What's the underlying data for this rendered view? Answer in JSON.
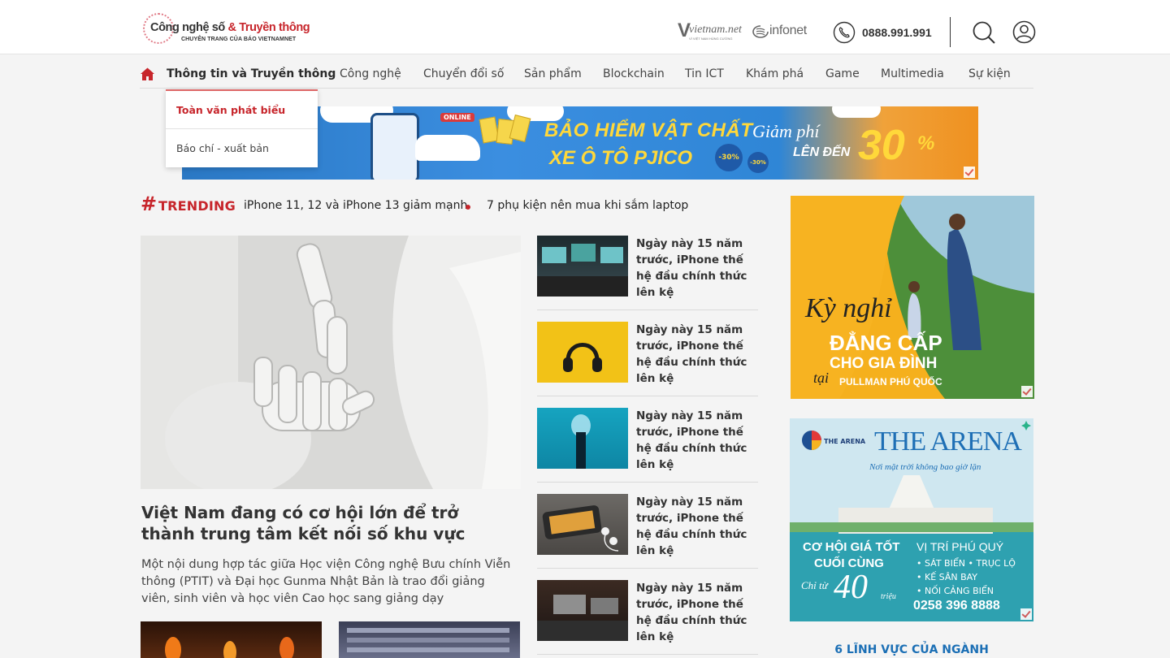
{
  "header": {
    "logo_main": "Công nghệ số",
    "logo_amp": "& Truyền thông",
    "logo_sub": "CHUYÊN TRANG CỦA BÁO VIETNAMNET",
    "partner_vietnamnet": "vietnam.net",
    "partner_vietnamnet_sub": "VÌ VIỆT NAM HÙNG CƯỜNG",
    "partner_infonet": "infonet",
    "hotline": "0888.991.991"
  },
  "nav": {
    "items": [
      "Thông tin và Truyền thông",
      "Công nghệ",
      "Chuyển đổi số",
      "Sản phẩm",
      "Blockchain",
      "Tin ICT",
      "Khám phá",
      "Game",
      "Multimedia",
      "Sự kiện"
    ],
    "dropdown": [
      "Toàn văn phát biểu",
      "Báo chí - xuất bản"
    ]
  },
  "banner": {
    "online": "ONLINE",
    "line1": "BẢO HIỂM VẬT CHẤT",
    "line2": "XE Ô TÔ PJICO",
    "badge": "-30%",
    "badge2": "-30%",
    "giam": "Giảm phí",
    "len_den": "LÊN ĐẾN",
    "value": "30",
    "pct": "%"
  },
  "trending": {
    "label": "TRENDING",
    "items": [
      "iPhone 11, 12 và iPhone 13 giảm mạnh",
      "7 phụ kiện nên mua khi sắm laptop"
    ]
  },
  "main": {
    "title": "Việt Nam đang có cơ hội lớn để trở thành trung tâm kết nối số khu vực",
    "sapo": "Một nội dung hợp tác giữa Học viện Công nghệ Bưu chính Viễn thông (PTIT) và Đại học Gunma Nhật Bản là trao đổi giảng viên, sinh viên và học viên Cao học sang giảng dạy"
  },
  "side": {
    "items": [
      {
        "title": "Ngày này 15 năm trước, iPhone thế hệ đầu chính thức lên kệ"
      },
      {
        "title": "Ngày này 15 năm trước, iPhone thế hệ đầu chính thức lên kệ"
      },
      {
        "title": "Ngày này 15 năm trước, iPhone thế hệ đầu chính thức lên kệ"
      },
      {
        "title": "Ngày này 15 năm trước, iPhone thế hệ đầu chính thức lên kệ"
      },
      {
        "title": "Ngày này 15 năm trước, iPhone thế hệ đầu chính thức lên kệ"
      }
    ]
  },
  "ads": {
    "pullman_script": "Kỳ nghỉ",
    "pullman_big": "ĐẲNG CẤP",
    "pullman_mid": "CHO GIA ĐÌNH",
    "pullman_tai": "tại",
    "pullman_place": "PULLMAN PHÚ QUỐC",
    "arena_logo": "THE ARENA",
    "arena_title": "THE ARENA",
    "arena_slogan": "Nơi mặt trời không bao giờ lặn",
    "arena_offer1": "CƠ HỘI GIÁ TỐT",
    "arena_offer2": "CUỐI CÙNG",
    "arena_vitri": "VỊ TRÍ PHÚ QUÝ",
    "arena_bullets": [
      "• SÁT BIỂN  • TRỤC LỘ",
      "• KẾ SÂN BAY",
      "• NỐI CẢNG BIỂN"
    ],
    "arena_chi_tu": "Chỉ từ",
    "arena_price": "40",
    "arena_trieu": "triệu",
    "arena_phone": "0258 396 8888"
  },
  "section_heading": "6 LĨNH VỰC CỦA NGÀNH",
  "colors": {
    "brand_red": "#c7252b",
    "link_blue": "#1b6fb5",
    "banner_blue": "#2f86d6",
    "banner_yellow": "#ffd83a"
  }
}
